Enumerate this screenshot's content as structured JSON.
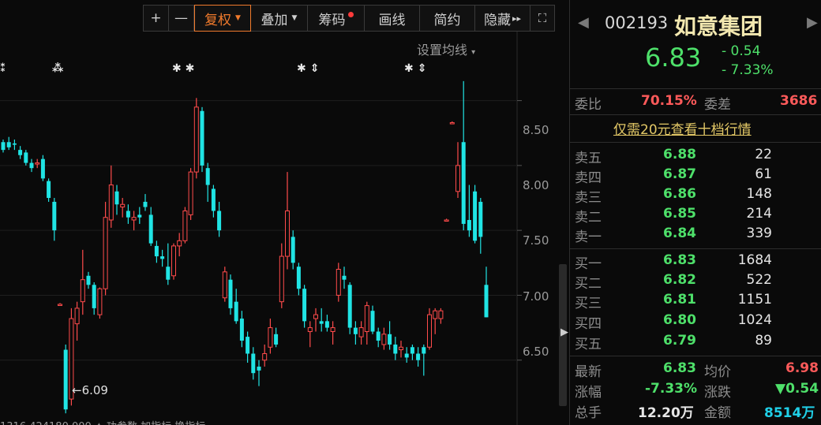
{
  "toolbar": {
    "plus": "+",
    "minus": "—",
    "fuquan": "复权",
    "diejia": "叠加",
    "chouma": "筹码",
    "huaxian": "画线",
    "jianyue": "简约",
    "yincang": "隐藏",
    "yincang_arrows": "▸▸",
    "expand": "⛶"
  },
  "chart": {
    "ma_setting": "设置均线",
    "y_ticks": [
      "8.50",
      "8.00",
      "7.50",
      "7.00",
      "6.50"
    ],
    "low_label": "6.09",
    "markers": [
      "⁂",
      "⁂",
      "✱ ✱",
      "✱ ⇕",
      "✱ ⇕"
    ],
    "bottom_text": "1316  424180.000  ✦                                          功参数  加指标  换指标"
  },
  "chart_data": {
    "type": "candlestick",
    "y_range": [
      6.0,
      8.85
    ],
    "y_ticks": [
      6.5,
      7.0,
      7.5,
      8.0,
      8.5
    ],
    "candles": [
      {
        "o": 8.18,
        "h": 8.2,
        "l": 8.1,
        "c": 8.12
      },
      {
        "o": 8.18,
        "h": 8.22,
        "l": 8.12,
        "c": 8.14
      },
      {
        "o": 8.17,
        "h": 8.2,
        "l": 8.12,
        "c": 8.16
      },
      {
        "o": 8.12,
        "h": 8.15,
        "l": 8.05,
        "c": 8.08
      },
      {
        "o": 8.1,
        "h": 8.12,
        "l": 8.0,
        "c": 8.02
      },
      {
        "o": 8.02,
        "h": 8.05,
        "l": 7.95,
        "c": 7.98
      },
      {
        "o": 8.02,
        "h": 8.05,
        "l": 7.98,
        "c": 8.02
      },
      {
        "o": 8.05,
        "h": 8.08,
        "l": 7.88,
        "c": 7.9
      },
      {
        "o": 7.88,
        "h": 7.9,
        "l": 7.72,
        "c": 7.75
      },
      {
        "o": 7.72,
        "h": 7.75,
        "l": 7.42,
        "c": 7.5
      },
      {
        "o": 6.93,
        "h": 6.94,
        "l": 6.92,
        "c": 6.93
      },
      {
        "o": 6.58,
        "h": 6.62,
        "l": 6.09,
        "c": 6.12
      },
      {
        "o": 6.2,
        "h": 6.9,
        "l": 6.15,
        "c": 6.82
      },
      {
        "o": 6.78,
        "h": 6.95,
        "l": 6.65,
        "c": 6.9
      },
      {
        "o": 6.95,
        "h": 7.35,
        "l": 6.85,
        "c": 7.12
      },
      {
        "o": 7.15,
        "h": 7.18,
        "l": 7.05,
        "c": 7.08
      },
      {
        "o": 7.08,
        "h": 7.1,
        "l": 6.85,
        "c": 6.9
      },
      {
        "o": 6.85,
        "h": 7.06,
        "l": 6.82,
        "c": 7.05
      },
      {
        "o": 7.05,
        "h": 7.72,
        "l": 7.0,
        "c": 7.6
      },
      {
        "o": 7.58,
        "h": 8.0,
        "l": 7.52,
        "c": 7.85
      },
      {
        "o": 7.8,
        "h": 7.85,
        "l": 7.62,
        "c": 7.7
      },
      {
        "o": 7.68,
        "h": 7.75,
        "l": 7.6,
        "c": 7.7
      },
      {
        "o": 7.65,
        "h": 7.7,
        "l": 7.55,
        "c": 7.6
      },
      {
        "o": 7.58,
        "h": 7.65,
        "l": 7.5,
        "c": 7.6
      },
      {
        "o": 7.62,
        "h": 7.68,
        "l": 7.55,
        "c": 7.6
      },
      {
        "o": 7.72,
        "h": 7.78,
        "l": 7.65,
        "c": 7.68
      },
      {
        "o": 7.62,
        "h": 7.68,
        "l": 7.38,
        "c": 7.4
      },
      {
        "o": 7.38,
        "h": 7.42,
        "l": 7.25,
        "c": 7.3
      },
      {
        "o": 7.3,
        "h": 7.35,
        "l": 7.22,
        "c": 7.28
      },
      {
        "o": 7.22,
        "h": 7.4,
        "l": 7.08,
        "c": 7.12
      },
      {
        "o": 7.15,
        "h": 7.4,
        "l": 7.12,
        "c": 7.38
      },
      {
        "o": 7.38,
        "h": 7.48,
        "l": 7.3,
        "c": 7.42
      },
      {
        "o": 7.42,
        "h": 7.68,
        "l": 7.4,
        "c": 7.65
      },
      {
        "o": 7.62,
        "h": 7.98,
        "l": 7.58,
        "c": 7.95
      },
      {
        "o": 7.95,
        "h": 8.52,
        "l": 7.9,
        "c": 8.45
      },
      {
        "o": 8.42,
        "h": 8.45,
        "l": 7.95,
        "c": 8.0
      },
      {
        "o": 7.98,
        "h": 8.02,
        "l": 7.72,
        "c": 7.85
      },
      {
        "o": 7.82,
        "h": 7.85,
        "l": 7.6,
        "c": 7.65
      },
      {
        "o": 7.65,
        "h": 7.72,
        "l": 7.45,
        "c": 7.5
      },
      {
        "o": 6.98,
        "h": 7.22,
        "l": 6.95,
        "c": 7.18
      },
      {
        "o": 7.12,
        "h": 7.16,
        "l": 6.85,
        "c": 6.9
      },
      {
        "o": 6.95,
        "h": 7.05,
        "l": 6.78,
        "c": 6.8
      },
      {
        "o": 6.82,
        "h": 6.88,
        "l": 6.6,
        "c": 6.65
      },
      {
        "o": 6.68,
        "h": 6.72,
        "l": 6.48,
        "c": 6.55
      },
      {
        "o": 6.55,
        "h": 6.6,
        "l": 6.35,
        "c": 6.4
      },
      {
        "o": 6.45,
        "h": 6.5,
        "l": 6.3,
        "c": 6.42
      },
      {
        "o": 6.5,
        "h": 6.62,
        "l": 6.45,
        "c": 6.55
      },
      {
        "o": 6.6,
        "h": 6.82,
        "l": 6.55,
        "c": 6.75
      },
      {
        "o": 6.7,
        "h": 6.75,
        "l": 6.6,
        "c": 6.62
      },
      {
        "o": 6.95,
        "h": 7.4,
        "l": 6.9,
        "c": 7.3
      },
      {
        "o": 7.3,
        "h": 7.95,
        "l": 7.2,
        "c": 7.65
      },
      {
        "o": 7.45,
        "h": 7.5,
        "l": 7.2,
        "c": 7.25
      },
      {
        "o": 7.22,
        "h": 7.25,
        "l": 7.0,
        "c": 7.05
      },
      {
        "o": 7.05,
        "h": 7.08,
        "l": 6.75,
        "c": 6.8
      },
      {
        "o": 6.72,
        "h": 6.8,
        "l": 6.6,
        "c": 6.75
      },
      {
        "o": 6.82,
        "h": 6.9,
        "l": 6.72,
        "c": 6.85
      },
      {
        "o": 6.8,
        "h": 6.9,
        "l": 6.72,
        "c": 6.78
      },
      {
        "o": 6.8,
        "h": 6.85,
        "l": 6.72,
        "c": 6.75
      },
      {
        "o": 6.72,
        "h": 6.8,
        "l": 6.62,
        "c": 6.75
      },
      {
        "o": 7.0,
        "h": 7.25,
        "l": 6.95,
        "c": 7.2
      },
      {
        "o": 7.15,
        "h": 7.22,
        "l": 7.05,
        "c": 7.12
      },
      {
        "o": 7.08,
        "h": 7.1,
        "l": 6.7,
        "c": 6.75
      },
      {
        "o": 6.75,
        "h": 6.8,
        "l": 6.62,
        "c": 6.7
      },
      {
        "o": 6.68,
        "h": 6.8,
        "l": 6.62,
        "c": 6.75
      },
      {
        "o": 6.72,
        "h": 6.95,
        "l": 6.62,
        "c": 6.92
      },
      {
        "o": 6.88,
        "h": 6.92,
        "l": 6.7,
        "c": 6.72
      },
      {
        "o": 6.72,
        "h": 6.75,
        "l": 6.6,
        "c": 6.65
      },
      {
        "o": 6.62,
        "h": 6.75,
        "l": 6.58,
        "c": 6.7
      },
      {
        "o": 6.7,
        "h": 6.8,
        "l": 6.58,
        "c": 6.62
      },
      {
        "o": 6.62,
        "h": 6.68,
        "l": 6.5,
        "c": 6.55
      },
      {
        "o": 6.58,
        "h": 6.65,
        "l": 6.52,
        "c": 6.6
      },
      {
        "o": 6.55,
        "h": 6.6,
        "l": 6.48,
        "c": 6.52
      },
      {
        "o": 6.6,
        "h": 6.62,
        "l": 6.5,
        "c": 6.55
      },
      {
        "o": 6.55,
        "h": 6.6,
        "l": 6.45,
        "c": 6.5
      },
      {
        "o": 6.6,
        "h": 6.62,
        "l": 6.38,
        "c": 6.55
      },
      {
        "o": 6.6,
        "h": 6.9,
        "l": 6.58,
        "c": 6.85
      },
      {
        "o": 6.82,
        "h": 6.9,
        "l": 6.7,
        "c": 6.88
      },
      {
        "o": 6.82,
        "h": 6.9,
        "l": 6.78,
        "c": 6.88
      },
      {
        "o": 7.58,
        "h": 7.59,
        "l": 7.57,
        "c": 7.58
      },
      {
        "o": 8.33,
        "h": 8.34,
        "l": 8.32,
        "c": 8.33
      },
      {
        "o": 7.8,
        "h": 8.18,
        "l": 7.75,
        "c": 8.0
      },
      {
        "o": 8.18,
        "h": 8.65,
        "l": 7.5,
        "c": 7.55
      },
      {
        "o": 7.58,
        "h": 7.85,
        "l": 7.45,
        "c": 7.5
      },
      {
        "o": 7.8,
        "h": 7.85,
        "l": 7.4,
        "c": 7.42
      },
      {
        "o": 7.72,
        "h": 7.75,
        "l": 7.32,
        "c": 7.45
      },
      {
        "o": 7.08,
        "h": 7.22,
        "l": 6.83,
        "c": 6.83
      }
    ]
  },
  "panel": {
    "code": "002193",
    "name": "如意集团",
    "price": "6.83",
    "change": "- 0.54",
    "change_pct": "- 7.33%",
    "weibi_label": "委比",
    "weibi_value": "70.15%",
    "weicha_label": "委差",
    "weicha_value": "3686",
    "promo": "仅需20元查看十档行情",
    "sell": [
      {
        "label": "卖五",
        "price": "6.88",
        "vol": "22"
      },
      {
        "label": "卖四",
        "price": "6.87",
        "vol": "61"
      },
      {
        "label": "卖三",
        "price": "6.86",
        "vol": "148"
      },
      {
        "label": "卖二",
        "price": "6.85",
        "vol": "214"
      },
      {
        "label": "卖一",
        "price": "6.84",
        "vol": "339"
      }
    ],
    "buy": [
      {
        "label": "买一",
        "price": "6.83",
        "vol": "1684"
      },
      {
        "label": "买二",
        "price": "6.82",
        "vol": "522"
      },
      {
        "label": "买三",
        "price": "6.81",
        "vol": "1151"
      },
      {
        "label": "买四",
        "price": "6.80",
        "vol": "1024"
      },
      {
        "label": "买五",
        "price": "6.79",
        "vol": "89"
      }
    ],
    "stats": {
      "latest_label": "最新",
      "latest": "6.83",
      "avg_label": "均价",
      "avg": "6.98",
      "chgpct_label": "涨幅",
      "chgpct": "-7.33%",
      "chg_label": "涨跌",
      "chg": "▼0.54",
      "vol_label": "总手",
      "vol": "12.20万",
      "amt_label": "金额",
      "amt": "8514万"
    }
  },
  "colors": {
    "up": "#ff4b4b",
    "down": "#20e4e4",
    "green": "#4ee06a",
    "accent": "#f07a2c"
  }
}
